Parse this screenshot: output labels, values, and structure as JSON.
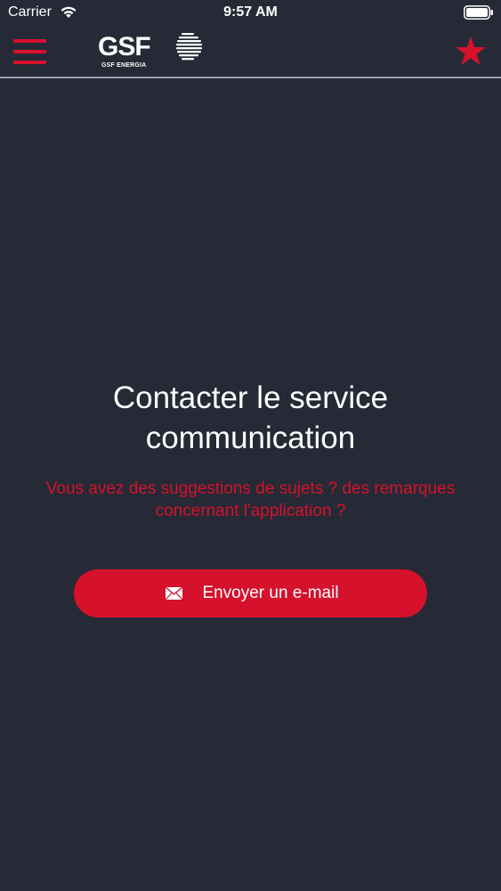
{
  "status_bar": {
    "carrier": "Carrier",
    "time": "9:57 AM"
  },
  "header": {
    "logo_text": "GSF",
    "logo_subtext": "GSF ENERGIA",
    "accent_color": "#d6112c",
    "icons": [
      "menu-icon",
      "star-icon"
    ]
  },
  "main": {
    "title": "Contacter le service communication",
    "subtitle": "Vous avez des suggestions de sujets ? des remarques concernant l'application ?",
    "email_button_label": "Envoyer un e-mail",
    "email_icon": "mail-icon"
  },
  "colors": {
    "background": "#262a36",
    "accent": "#d6112c",
    "text": "#ffffff"
  }
}
